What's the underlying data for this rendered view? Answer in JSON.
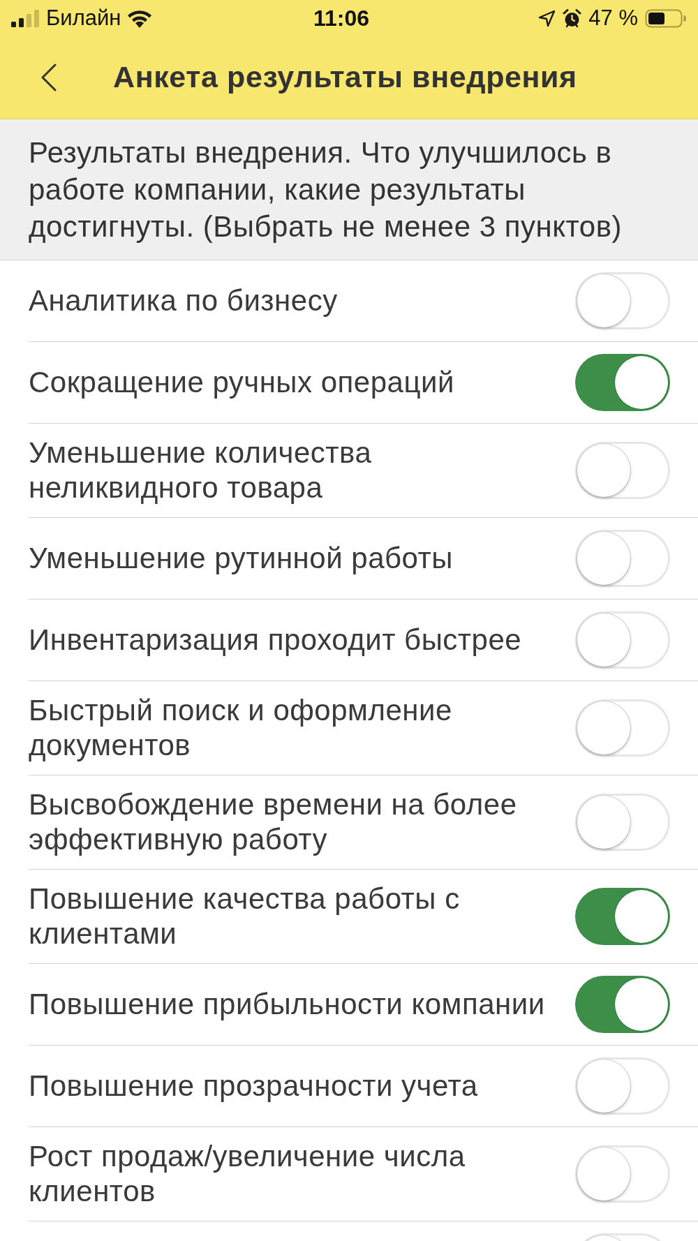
{
  "status_bar": {
    "carrier": "Билайн",
    "time": "11:06",
    "battery": "47 %"
  },
  "header": {
    "title": "Анкета результаты внедрения"
  },
  "description": "Результаты внедрения. Что улучшилось в работе компании, какие результаты достигнуты. (Выбрать не менее 3 пунктов)",
  "items": [
    {
      "label": "Аналитика по бизнесу",
      "on": false
    },
    {
      "label": "Сокращение ручных операций",
      "on": true
    },
    {
      "label": "Уменьшение количества неликвидного товара",
      "on": false
    },
    {
      "label": "Уменьшение рутинной работы",
      "on": false
    },
    {
      "label": "Инвентаризация проходит быстрее",
      "on": false
    },
    {
      "label": "Быстрый поиск и оформление документов",
      "on": false
    },
    {
      "label": "Высвобождение времени на более эффективную работу",
      "on": false
    },
    {
      "label": "Повышение качества работы с клиентами",
      "on": true
    },
    {
      "label": "Повышение прибыльности компании",
      "on": true
    },
    {
      "label": "Повышение прозрачности учета",
      "on": false
    },
    {
      "label": "Рост продаж/увеличение числа клиентов",
      "on": false
    },
    {
      "on": false
    }
  ]
}
